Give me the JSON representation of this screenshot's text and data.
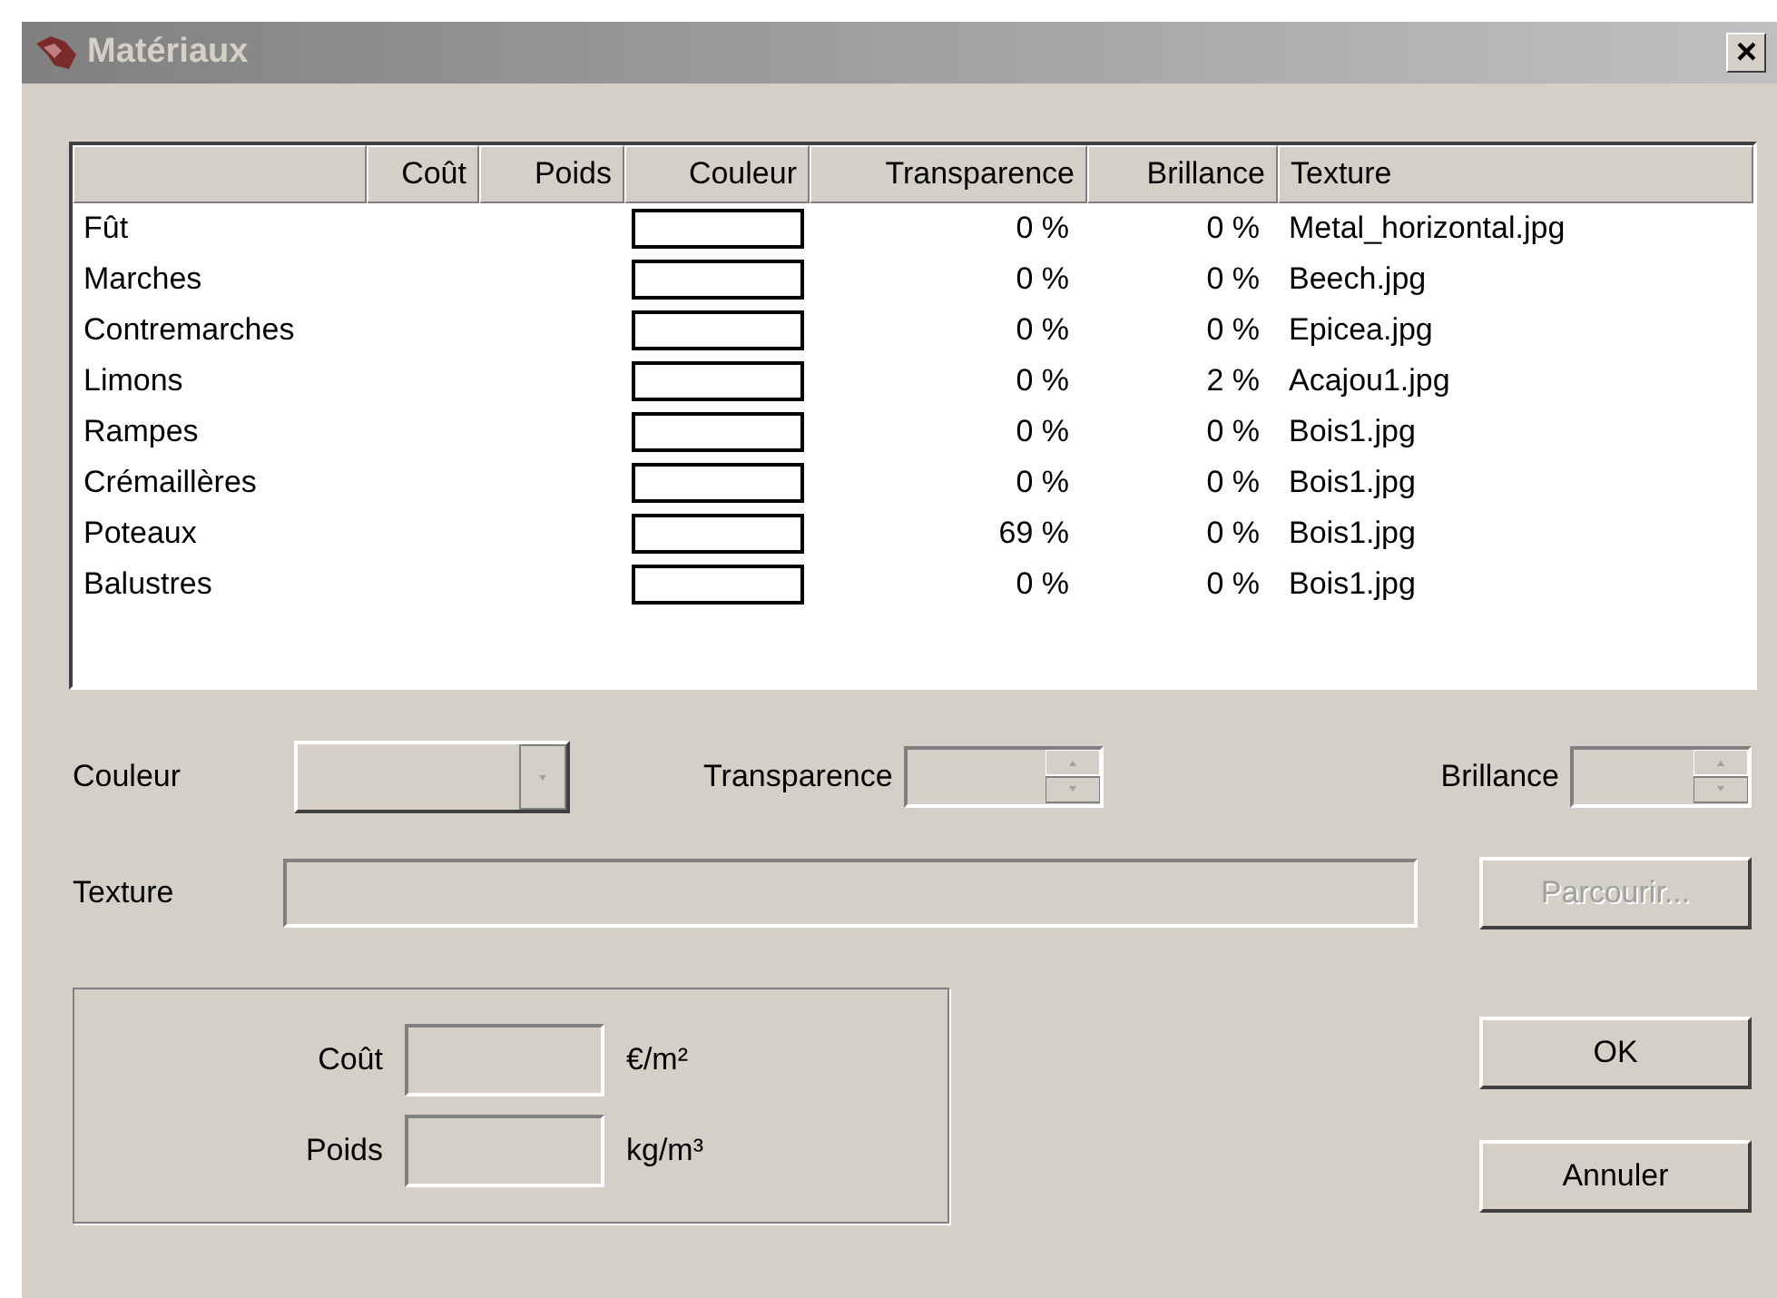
{
  "window": {
    "title": "Matériaux",
    "close": "×"
  },
  "table": {
    "columns": [
      "",
      "Coût",
      "Poids",
      "Couleur",
      "Transparence",
      "Brillance",
      "Texture"
    ],
    "rows": [
      {
        "name": "Fût",
        "color": "#ffffff",
        "transparence": "0 %",
        "brillance": "0 %",
        "texture": "Metal_horizontal.jpg"
      },
      {
        "name": "Marches",
        "color": "#ffffff",
        "transparence": "0 %",
        "brillance": "0 %",
        "texture": "Beech.jpg"
      },
      {
        "name": "Contremarches",
        "color": "#ffffff",
        "transparence": "0 %",
        "brillance": "0 %",
        "texture": "Epicea.jpg"
      },
      {
        "name": "Limons",
        "color": "#ffffff",
        "transparence": "0 %",
        "brillance": "2 %",
        "texture": "Acajou1.jpg"
      },
      {
        "name": "Rampes",
        "color": "#ffffff",
        "transparence": "0 %",
        "brillance": "0 %",
        "texture": "Bois1.jpg"
      },
      {
        "name": "Crémaillères",
        "color": "#ffffff",
        "transparence": "0 %",
        "brillance": "0 %",
        "texture": "Bois1.jpg"
      },
      {
        "name": "Poteaux",
        "color": "#ffffff",
        "transparence": "69 %",
        "brillance": "0 %",
        "texture": "Bois1.jpg"
      },
      {
        "name": "Balustres",
        "color": "#ffffff",
        "transparence": "0 %",
        "brillance": "0 %",
        "texture": "Bois1.jpg"
      }
    ]
  },
  "form": {
    "couleur_label": "Couleur",
    "transparence_label": "Transparence",
    "brillance_label": "Brillance",
    "texture_label": "Texture",
    "browse_button": {
      "label": "Parcourir...",
      "disabled": true
    }
  },
  "unit_group": {
    "cout_label": "Coût",
    "cout_unit": "€/m²",
    "poids_label": "Poids",
    "poids_unit": "kg/m³"
  },
  "buttons": [
    "OK",
    "Annuler"
  ]
}
